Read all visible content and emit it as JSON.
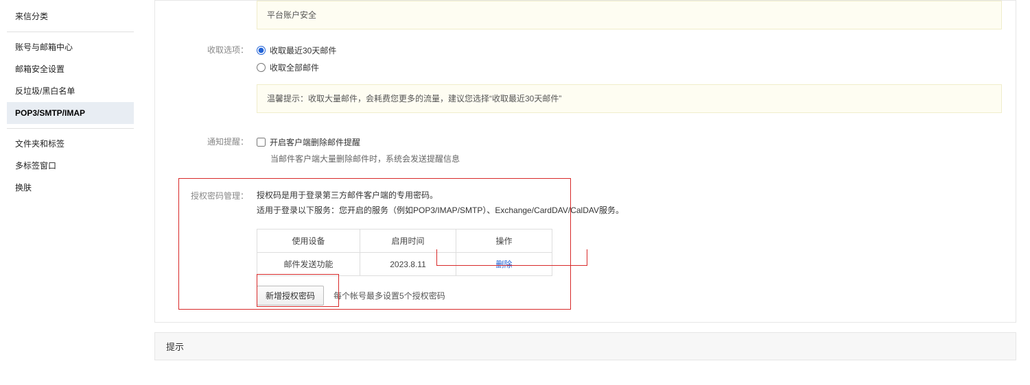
{
  "sidebar": {
    "items": [
      {
        "label": "来信分类",
        "selected": false
      },
      {
        "label": "账号与邮箱中心",
        "selected": false
      },
      {
        "label": "邮箱安全设置",
        "selected": false
      },
      {
        "label": "反垃圾/黑白名单",
        "selected": false
      },
      {
        "label": "POP3/SMTP/IMAP",
        "selected": true
      },
      {
        "label": "文件夹和标签",
        "selected": false
      },
      {
        "label": "多标签窗口",
        "selected": false
      },
      {
        "label": "换肤",
        "selected": false
      }
    ]
  },
  "topNote": "平台账户安全",
  "receiveOption": {
    "label": "收取选项：",
    "opt1": "收取最近30天邮件",
    "opt2": "收取全部邮件",
    "note": "温馨提示：收取大量邮件，会耗费您更多的流量，建议您选择“收取最近30天邮件”"
  },
  "notify": {
    "label": "通知提醒：",
    "opt": "开启客户端删除邮件提醒",
    "desc": "当邮件客户端大量删除邮件时，系统会发送提醒信息"
  },
  "auth": {
    "label": "授权密码管理：",
    "desc1": "授权码是用于登录第三方邮件客户端的专用密码。",
    "desc2": "适用于登录以下服务：您开启的服务（例如POP3/IMAP/SMTP）、Exchange/CardDAV/CalDAV服务。",
    "table": {
      "headers": [
        "使用设备",
        "启用时间",
        "操作"
      ],
      "rows": [
        {
          "device": "邮件发送功能",
          "time": "2023.8.11",
          "action": "删除"
        }
      ]
    },
    "addBtn": "新增授权密码",
    "addNote": "每个帐号最多设置5个授权密码"
  },
  "hint": {
    "title": "提示"
  }
}
